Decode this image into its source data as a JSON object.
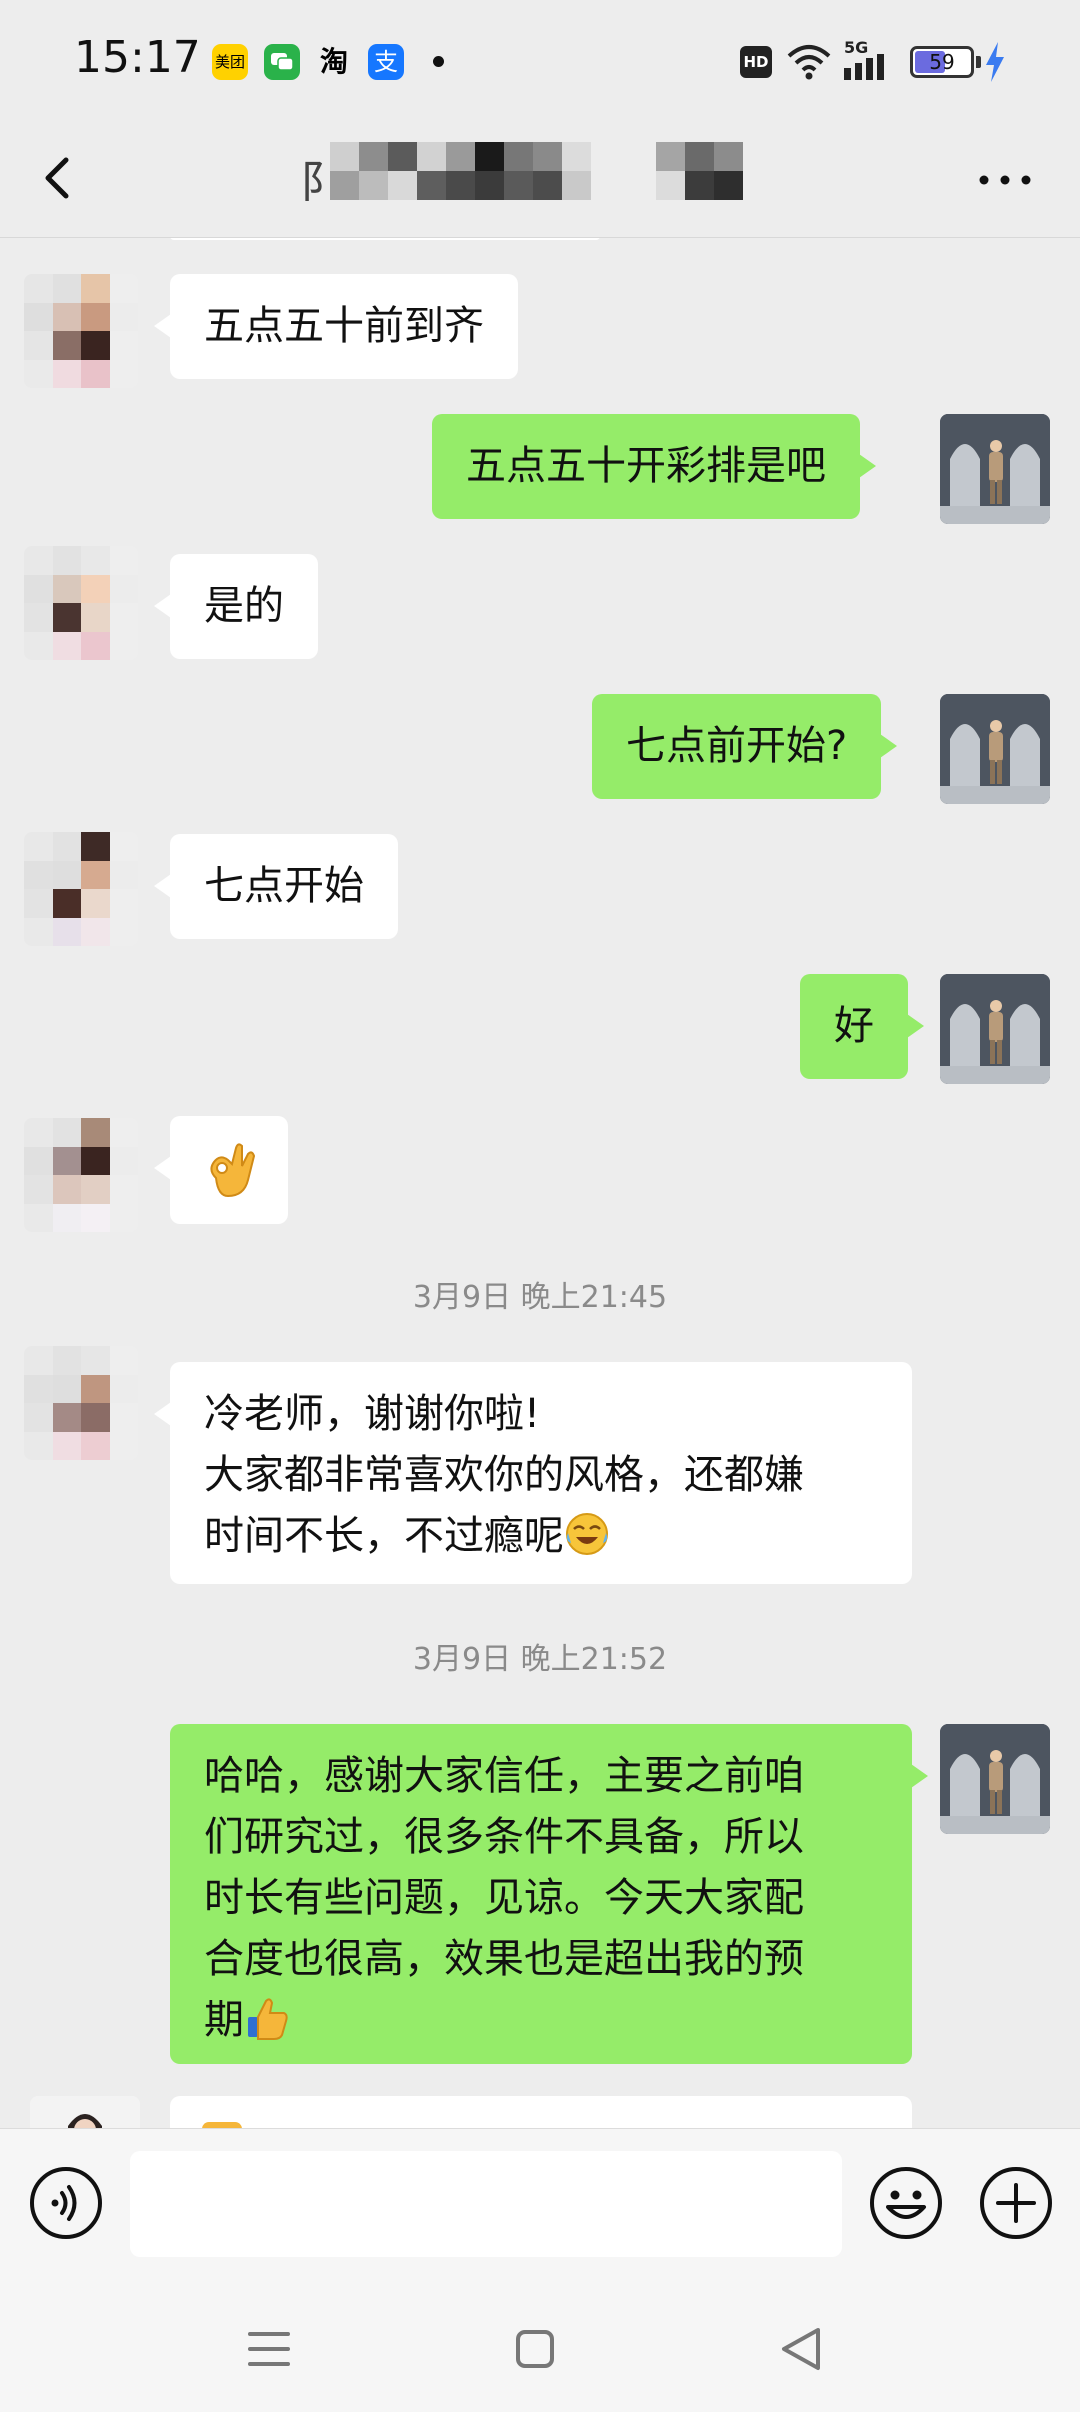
{
  "status_bar": {
    "time": "15:17",
    "app_icons": [
      {
        "name": "meituan-icon",
        "label": "美团",
        "color": "#ffd100"
      },
      {
        "name": "wechat-chat-icon",
        "label": "",
        "color": "#2ab24a"
      },
      {
        "name": "taobao-icon",
        "label": "淘",
        "color": "#ededed"
      },
      {
        "name": "alipay-icon",
        "label": "支",
        "color": "#1677ff"
      }
    ],
    "hd_label": "HD",
    "network_label": "5G",
    "battery_percent": 59,
    "battery_label": "59",
    "charging": true
  },
  "header": {
    "title_visible_char": "阝"
  },
  "messages": [
    {
      "id": "m1",
      "side": "in",
      "text": "五点五十前到齐"
    },
    {
      "id": "m2",
      "side": "out",
      "text": "五点五十开彩排是吧"
    },
    {
      "id": "m3",
      "side": "in",
      "text": "是的"
    },
    {
      "id": "m4",
      "side": "out",
      "text": "七点前开始?"
    },
    {
      "id": "m5",
      "side": "in",
      "text": "七点开始"
    },
    {
      "id": "m6",
      "side": "out",
      "text": "好"
    },
    {
      "id": "m7",
      "side": "in",
      "text": "",
      "emoji": "ok-hand-emoji"
    },
    {
      "id": "t1",
      "type": "timestamp",
      "text": "3月9日 晚上21:45"
    },
    {
      "id": "m8",
      "side": "in",
      "text": "冷老师，谢谢你啦!\n大家都非常喜欢你的风格，还都嫌\n时间不长，不过瘾呢",
      "emoji": "laughing-crying-emoji"
    },
    {
      "id": "t2",
      "type": "timestamp",
      "text": "3月9日 晚上21:52"
    },
    {
      "id": "m9",
      "side": "out",
      "text": "哈哈，感谢大家信任，主要之前咱\n们研究过，很多条件不具备，所以\n时长有些问题，见谅。今天大家配\n合度也很高，效果也是超出我的预\n期",
      "emoji": "thumbs-up-emoji"
    }
  ],
  "input_bar": {
    "placeholder": "",
    "value": ""
  },
  "colors": {
    "background": "#ededed",
    "incoming_bubble": "#ffffff",
    "outgoing_bubble": "#95ec69",
    "timestamp_text": "#8a8a8a"
  }
}
